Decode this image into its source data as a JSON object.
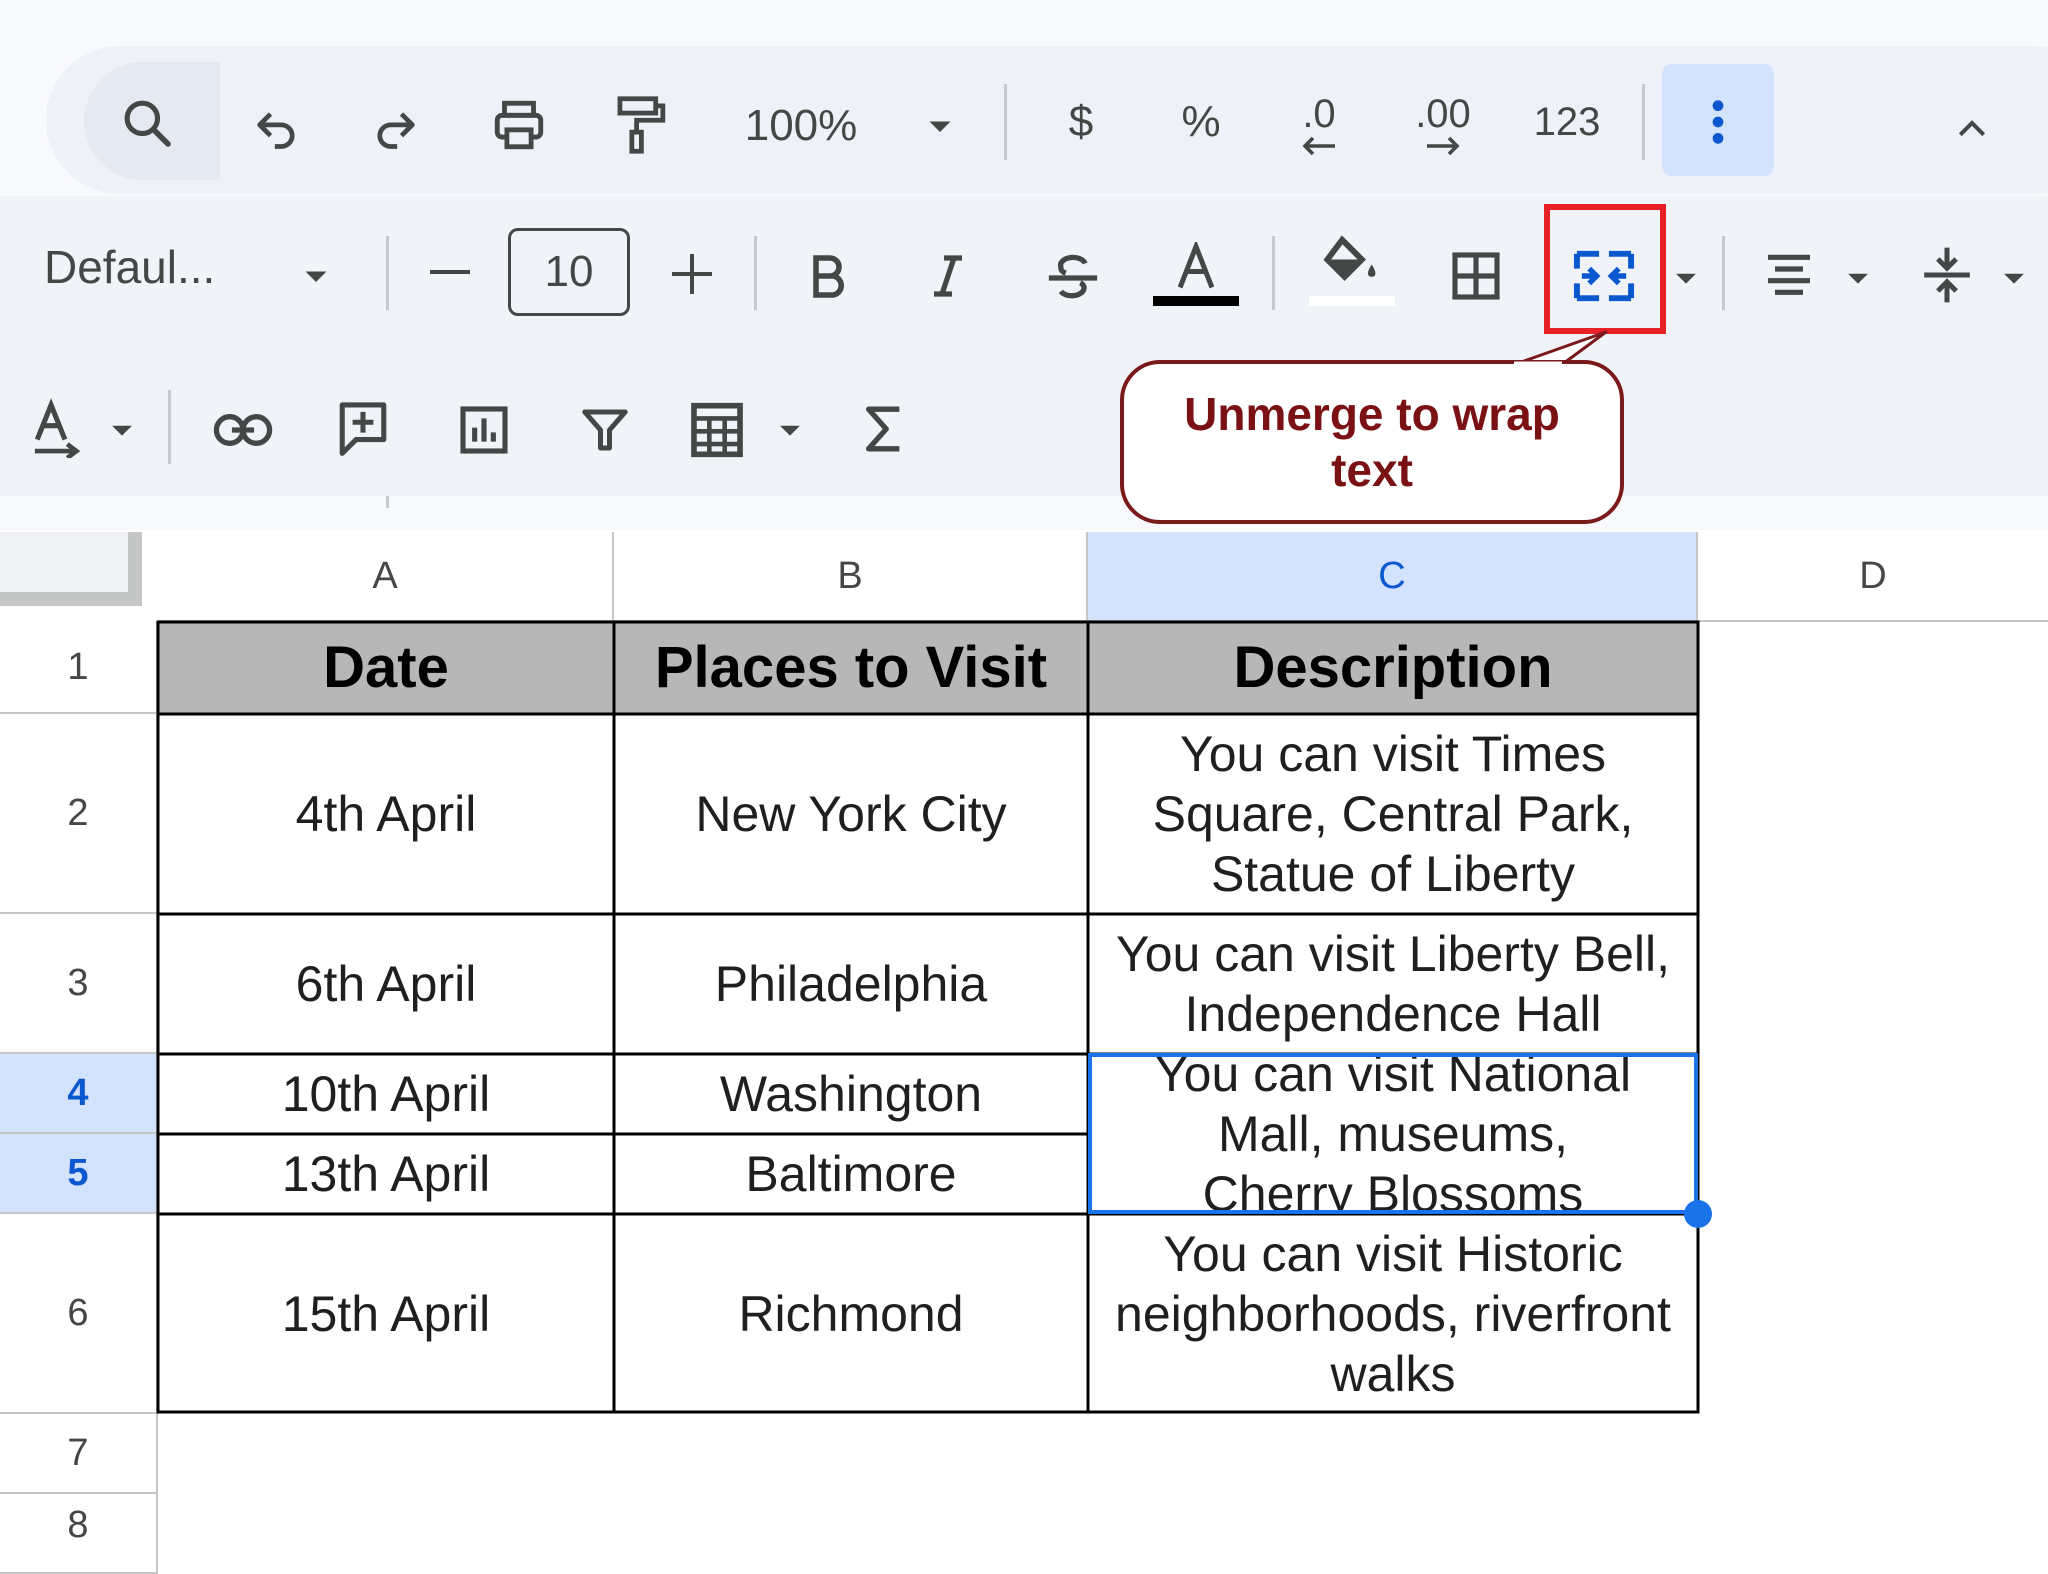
{
  "toolbar": {
    "zoom": "100%",
    "currency": "$",
    "percent": "%",
    "dec_decrease": ".0",
    "dec_increase": ".00",
    "number_format": "123"
  },
  "format_bar": {
    "font_name": "Defaul...",
    "font_size": "10"
  },
  "callout": {
    "text": "Unmerge to wrap text"
  },
  "colors": {
    "highlight_border": "#e8202a",
    "selection_blue": "#1a73e8",
    "header_fill": "#b7b7b7",
    "callout_text": "#7a1114"
  },
  "grid": {
    "columns": [
      "A",
      "B",
      "C",
      "D"
    ],
    "rows": [
      "1",
      "2",
      "3",
      "4",
      "5",
      "6",
      "7",
      "8"
    ],
    "header": {
      "date": "Date",
      "places": "Places to Visit",
      "description": "Description"
    },
    "data": [
      {
        "date": "4th April",
        "place": "New York City",
        "description": "You can visit Times Square, Central Park, Statue of Liberty"
      },
      {
        "date": "6th April",
        "place": "Philadelphia",
        "description": "You can visit Liberty Bell, Independence Hall"
      },
      {
        "date": "10th April",
        "place": "Washington",
        "description": "You can visit National Mall, museums, Cherry Blossoms"
      },
      {
        "date": "13th April",
        "place": "Baltimore"
      },
      {
        "date": "15th April",
        "place": "Richmond",
        "description": "You can visit Historic neighborhoods, riverfront walks"
      }
    ]
  }
}
